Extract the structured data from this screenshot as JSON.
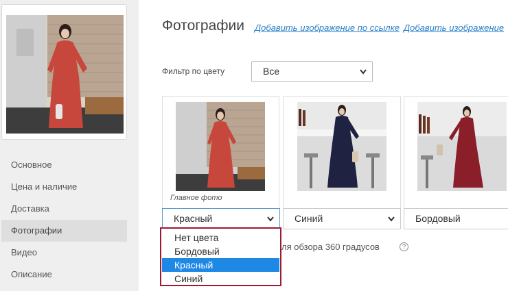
{
  "sidebar": {
    "menu": [
      {
        "label": "Основное"
      },
      {
        "label": "Цена и наличие"
      },
      {
        "label": "Доставка"
      },
      {
        "label": "Фотографии",
        "active": true
      },
      {
        "label": "Видео"
      },
      {
        "label": "Описание"
      }
    ]
  },
  "header": {
    "title": "Фотографии",
    "link_by_url": "Добавить изображение по ссылке",
    "link_add": "Добавить изображение"
  },
  "filter": {
    "label": "Фильтр по цвету",
    "selected": "Все"
  },
  "photos": [
    {
      "caption": "Главное фото",
      "color": "Красный",
      "dress_color": "#c8473d"
    },
    {
      "caption": "",
      "color": "Синий",
      "dress_color": "#1f2240"
    },
    {
      "caption": "",
      "color": "Бордовый",
      "dress_color": "#8a1f2a"
    }
  ],
  "note": {
    "text": "ля обзора 360 градусов",
    "help": "?"
  },
  "dropdown": {
    "options": [
      "Нет цвета",
      "Бордовый",
      "Красный",
      "Синий"
    ],
    "selected": "Красный",
    "border_color": "#9b1b30",
    "highlight_color": "#1e88e5"
  }
}
